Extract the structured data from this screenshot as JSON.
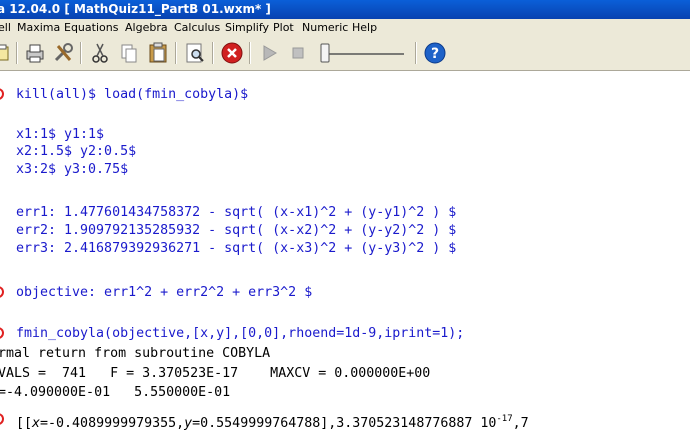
{
  "window": {
    "title": "a 12.04.0  [ MathQuiz11_PartB 01.wxm* ]"
  },
  "menu": [
    "ell",
    "Maxima",
    "Equations",
    "Algebra",
    "Calculus",
    "Simplify",
    "Plot",
    "Numeric",
    "Help"
  ],
  "toolbar": {
    "icons": [
      "open-icon",
      "print-icon",
      "settings-icon",
      "cut-icon",
      "copy-icon",
      "paste-icon",
      "find-icon",
      "stop-icon",
      "play-icon",
      "stop-animation-icon",
      "animation-slider",
      "help-icon"
    ],
    "colors": {
      "stop": "#d02020",
      "help": "#1e62c8"
    }
  },
  "document": {
    "cells": [
      {
        "input": "kill(all)$ load(fmin_cobyla)$"
      },
      {
        "input_lines": [
          "x1:1$ y1:1$",
          "x2:1.5$ y2:0.5$",
          "x3:2$ y3:0.75$"
        ]
      },
      {
        "input_lines": [
          "err1: 1.477601434758372 - sqrt( (x-x1)^2 + (y-y1)^2 ) $",
          "err2: 1.909792135285932 - sqrt( (x-x2)^2 + (y-y2)^2 ) $",
          "err3: 2.416879392936271 - sqrt( (x-x3)^2 + (y-y3)^2 ) $"
        ]
      },
      {
        "input": "objective: err1^2 + err2^2 + err3^2 $"
      },
      {
        "input": "fmin_cobyla(objective,[x,y],[0,0],rhoend=1d-9,iprint=1);"
      }
    ],
    "output_lines": [
      "rmal return from subroutine COBYLA",
      "VALS =  741   F = 3.370523E-17    MAXCV = 0.000000E+00",
      "=-4.090000E-01   5.550000E-01"
    ],
    "result": {
      "open": "[[",
      "x_name": "x",
      "x_value": "=-0.4089999979355,",
      "y_name": "y",
      "y_value": "=0.5549999764788",
      "close": "],3.370523148776887 10",
      "exponent": "-17",
      "tail": ",7"
    },
    "colors": {
      "input": "#1a1acc",
      "marker": "#e02020"
    }
  }
}
